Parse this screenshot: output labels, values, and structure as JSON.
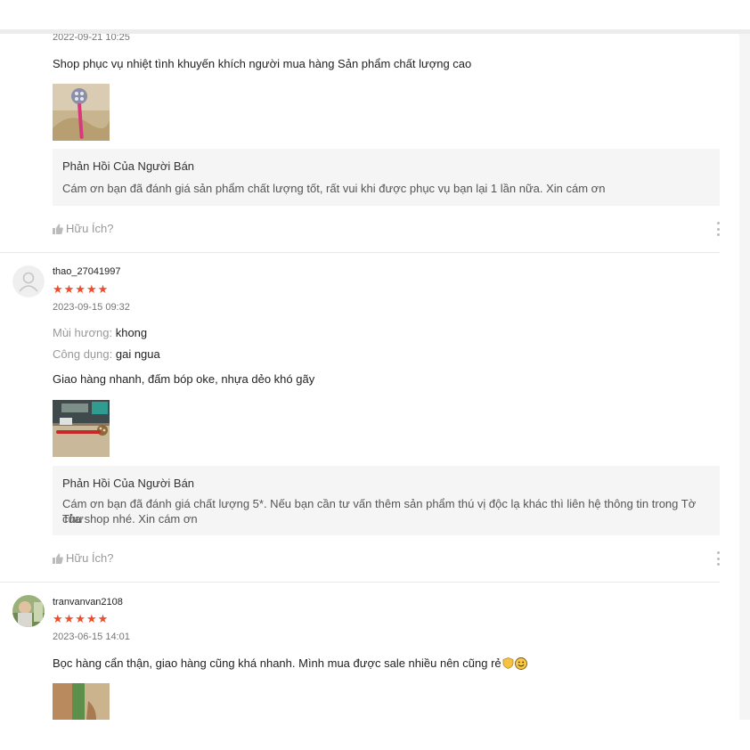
{
  "colors": {
    "star": "#ee4d2d",
    "muted": "#999999",
    "reply_bg": "#f5f5f5"
  },
  "reviews": [
    {
      "date": "2022-09-21 10:25",
      "comment": "Shop phục vụ nhiệt tình khuyến khích người mua hàng Sản phẩm chất lượng cao",
      "seller_reply": {
        "title": "Phản Hồi Của Người Bán",
        "text": "Cám ơn bạn đã đánh giá sản phẩm chất lượng tốt, rất vui khi được phục vụ bạn lại 1 lần nữa. Xin cám ơn"
      },
      "helpful_label": "Hữu Ích?",
      "helpful_icon": "thumbs-up-icon"
    },
    {
      "username": "thao_27041997",
      "avatar_icon": "default-user-icon",
      "rating": 5,
      "stars": "★★★★★",
      "date": "2023-09-15 09:32",
      "attributes": [
        {
          "label": "Mùi hương:",
          "value": "khong"
        },
        {
          "label": "Công dụng:",
          "value": "gai ngua"
        }
      ],
      "comment": "Giao hàng nhanh, đấm bóp oke, nhựa dẻo khó gãy",
      "seller_reply": {
        "title": "Phản Hồi Của Người Bán",
        "text_line1": "Cám ơn bạn đã đánh giá chất lượng 5*. Nếu bạn cần tư vấn thêm sản phẩm thú vị độc lạ khác thì liên hệ thông tin trong Tờ Thư",
        "text_line2": "của shop nhé. Xin cám ơn"
      },
      "helpful_label": "Hữu Ích?",
      "helpful_icon": "thumbs-up-icon"
    },
    {
      "username": "tranvanvan2108",
      "rating": 5,
      "stars": "★★★★★",
      "date": "2023-06-15 14:01",
      "comment": "Bọc hàng cẩn thận, giao hàng cũng khá nhanh. Mình mua được sale nhiều nên cũng rẻ",
      "emoji": [
        "shield-emoji",
        "smile-emoji"
      ]
    }
  ]
}
